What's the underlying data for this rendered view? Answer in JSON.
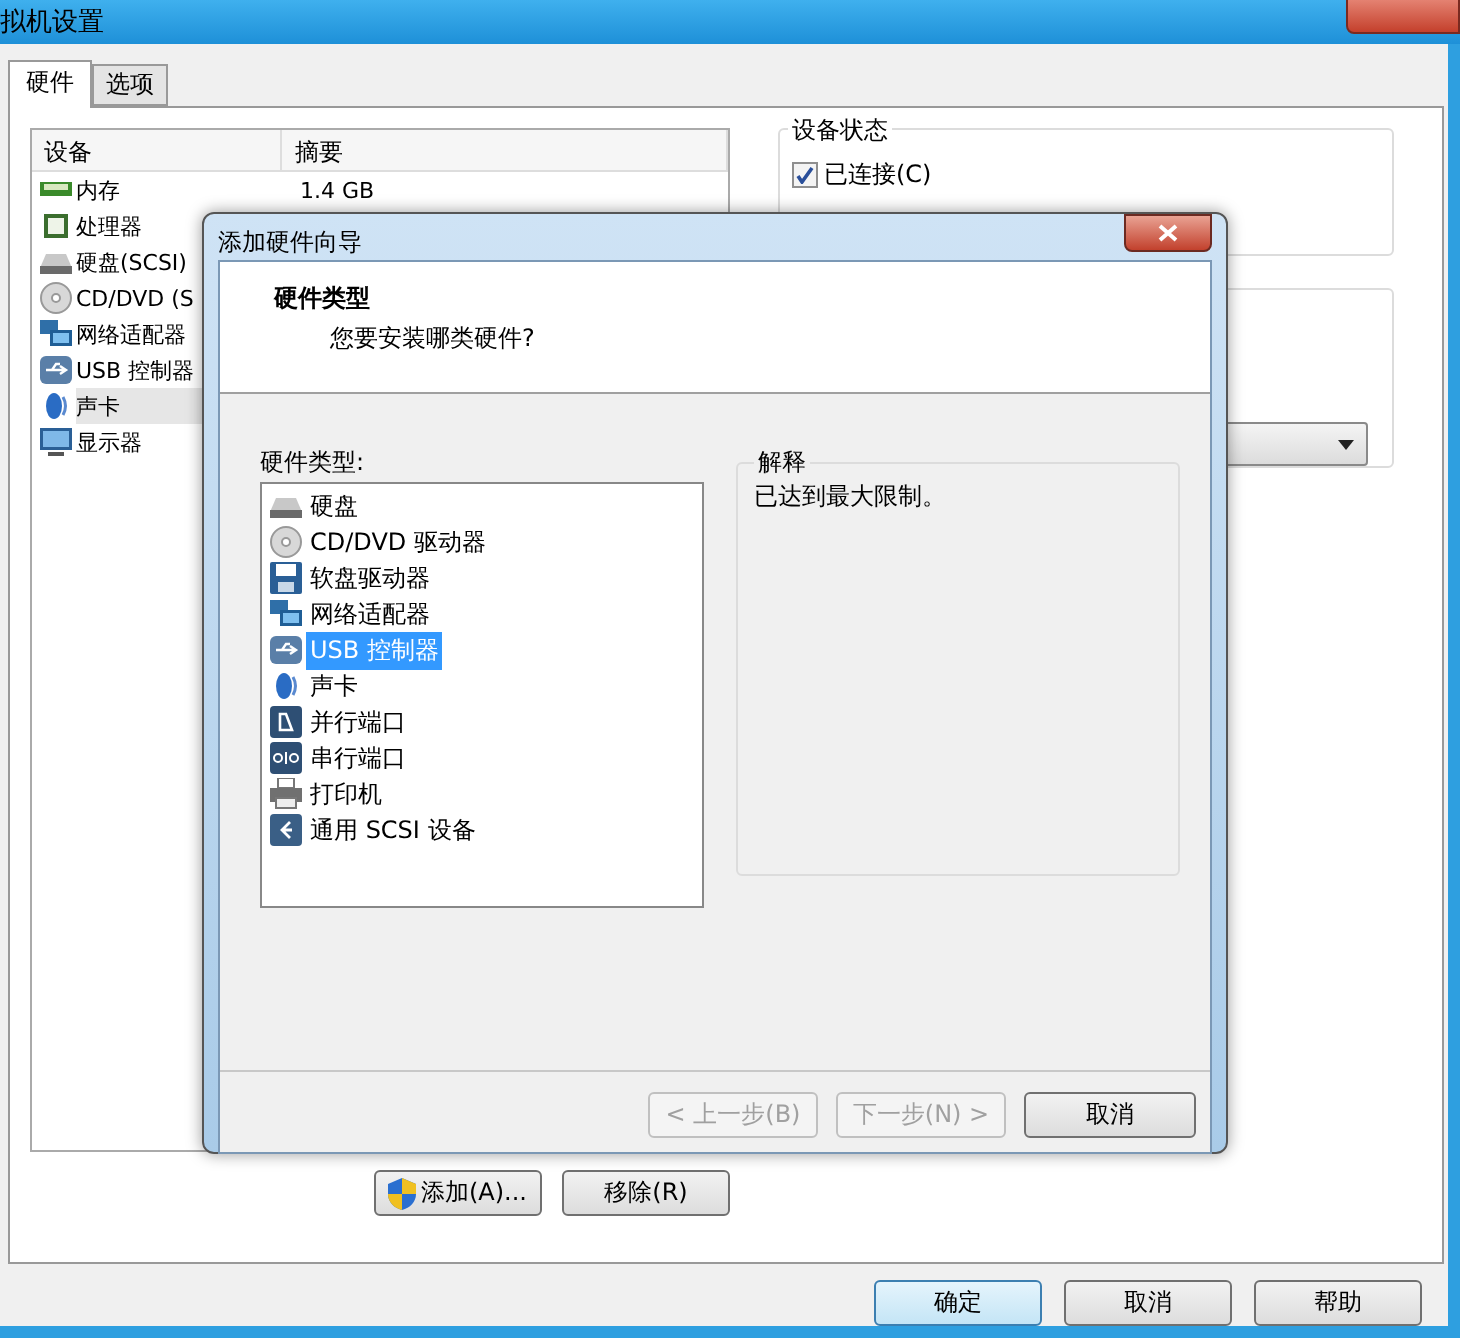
{
  "window": {
    "title": "拟机设置"
  },
  "tabs": [
    {
      "label": "硬件",
      "selected": true
    },
    {
      "label": "选项",
      "selected": false
    }
  ],
  "device_table": {
    "columns": [
      "设备",
      "摘要"
    ],
    "rows": [
      {
        "kind": "memory",
        "device": "内存",
        "summary": "1.4 GB",
        "selected": false
      },
      {
        "kind": "cpu",
        "device": "处理器",
        "selected": false
      },
      {
        "kind": "disk",
        "device": "硬盘(SCSI)",
        "selected": false
      },
      {
        "kind": "cdrom",
        "device": "CD/DVD (S",
        "selected": false
      },
      {
        "kind": "network",
        "device": "网络适配器",
        "selected": false
      },
      {
        "kind": "usb",
        "device": "USB 控制器",
        "selected": false
      },
      {
        "kind": "sound",
        "device": "声卡",
        "selected": true
      },
      {
        "kind": "display",
        "device": "显示器",
        "selected": false
      }
    ]
  },
  "device_status": {
    "title": "设备状态",
    "connected": {
      "label": "已连接(C)",
      "checked": true
    }
  },
  "list_buttons": [
    "添加(A)...",
    "移除(R)"
  ],
  "footer_buttons": [
    {
      "label": "确定",
      "default": true
    },
    {
      "label": "取消",
      "default": false
    },
    {
      "label": "帮助",
      "default": false
    }
  ],
  "wizard": {
    "title": "添加硬件向导",
    "heading": "硬件类型",
    "subheading": "您要安装哪类硬件?",
    "list_label": "硬件类型:",
    "items": [
      {
        "kind": "disk",
        "label": "硬盘",
        "selected": false
      },
      {
        "kind": "cdrom",
        "label": "CD/DVD 驱动器",
        "selected": false
      },
      {
        "kind": "floppy",
        "label": "软盘驱动器",
        "selected": false
      },
      {
        "kind": "network",
        "label": "网络适配器",
        "selected": false
      },
      {
        "kind": "usb",
        "label": "USB 控制器",
        "selected": true
      },
      {
        "kind": "sound",
        "label": "声卡",
        "selected": false
      },
      {
        "kind": "parallel",
        "label": "并行端口",
        "selected": false
      },
      {
        "kind": "serial",
        "label": "串行端口",
        "selected": false
      },
      {
        "kind": "printer",
        "label": "打印机",
        "selected": false
      },
      {
        "kind": "scsi",
        "label": "通用 SCSI 设备",
        "selected": false
      }
    ],
    "explanation": {
      "title": "解释",
      "text": "已达到最大限制。"
    },
    "buttons": [
      {
        "label": "< 上一步(B)",
        "disabled": true
      },
      {
        "label": "下一步(N) >",
        "disabled": true
      },
      {
        "label": "取消",
        "disabled": false
      }
    ]
  }
}
